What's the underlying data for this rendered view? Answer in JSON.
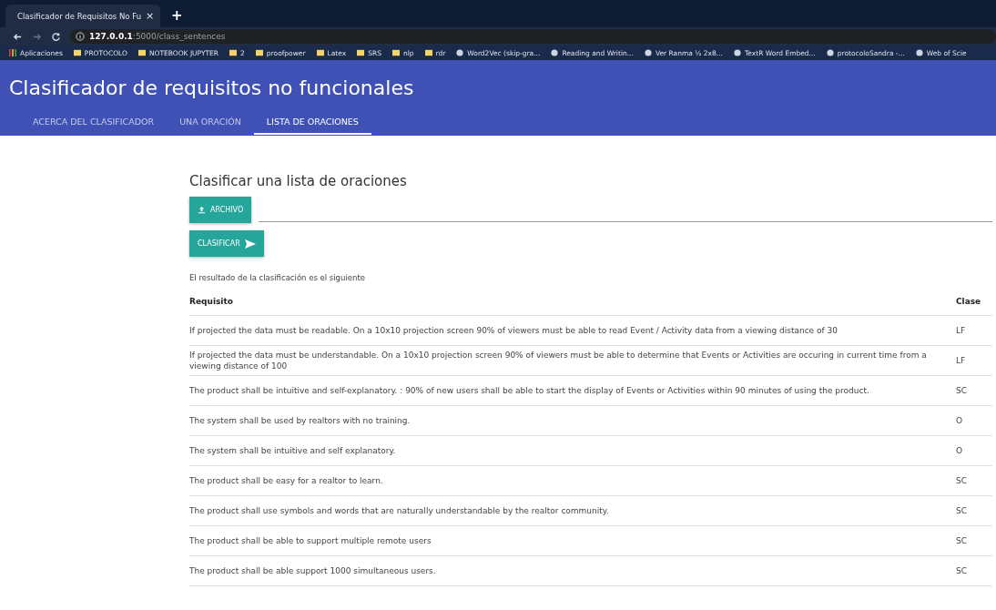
{
  "browser": {
    "tab_title": "Clasificador de Requisitos No Fu",
    "tab_close": "×",
    "new_tab": "+",
    "url_host": "127.0.0.1",
    "url_path": ":5000/class_sentences",
    "bookmarks": [
      {
        "kind": "apps",
        "label": "Aplicaciones"
      },
      {
        "kind": "folder",
        "label": "PROTOCOLO"
      },
      {
        "kind": "folder",
        "label": "NOTEBOOK JUPYTER"
      },
      {
        "kind": "folder",
        "label": "2"
      },
      {
        "kind": "folder",
        "label": "proofpower"
      },
      {
        "kind": "folder",
        "label": "Latex"
      },
      {
        "kind": "folder",
        "label": "SRS"
      },
      {
        "kind": "folder",
        "label": "nlp"
      },
      {
        "kind": "folder",
        "label": "rdr"
      },
      {
        "kind": "site",
        "label": "Word2Vec (skip-gra..."
      },
      {
        "kind": "site",
        "label": "Reading and Writin..."
      },
      {
        "kind": "site",
        "label": "Ver Ranma ½ 2x8..."
      },
      {
        "kind": "site",
        "label": "TextR Word Embed..."
      },
      {
        "kind": "site",
        "label": "protocoloSandra -..."
      },
      {
        "kind": "site",
        "label": "Web of Scie"
      }
    ]
  },
  "app": {
    "title": "Clasificador de requisitos no funcionales",
    "tabs": [
      {
        "label": "ACERCA DEL CLASIFICADOR",
        "selected": false
      },
      {
        "label": "UNA ORACIÓN",
        "selected": false
      },
      {
        "label": "LISTA DE ORACIONES",
        "selected": true
      }
    ]
  },
  "page": {
    "heading": "Clasificar una lista de oraciones",
    "file_button": "ARCHIVO",
    "classify_button": "CLASIFICAR",
    "result_text": "El resultado de la clasificación es el siguiente",
    "table": {
      "columns": [
        "Requisito",
        "Clase"
      ],
      "rows": [
        [
          "If projected the data must be readable. On a 10x10 projection screen 90% of viewers must be able to read Event / Activity data from a viewing distance of 30",
          "LF"
        ],
        [
          "If projected the data must be understandable. On a 10x10 projection screen 90% of viewers must be able to determine that Events or Activities are occuring in current time from a viewing distance of 100",
          "LF"
        ],
        [
          "The product shall be intuitive and self-explanatory. : 90% of new users shall be able to start the display of Events or Activities within 90 minutes of using the product.",
          "SC"
        ],
        [
          "The system shall be used by realtors with no training.",
          "O"
        ],
        [
          "The system shall be intuitive and self explanatory.",
          "O"
        ],
        [
          "The product shall be easy for a realtor to learn.",
          "SC"
        ],
        [
          "The product shall use symbols and words that are naturally understandable by the realtor community.",
          "SC"
        ],
        [
          "The product shall be able to support multiple remote users",
          "SC"
        ],
        [
          "The product shall be able support 1000 simultaneous users.",
          "SC"
        ]
      ]
    }
  }
}
